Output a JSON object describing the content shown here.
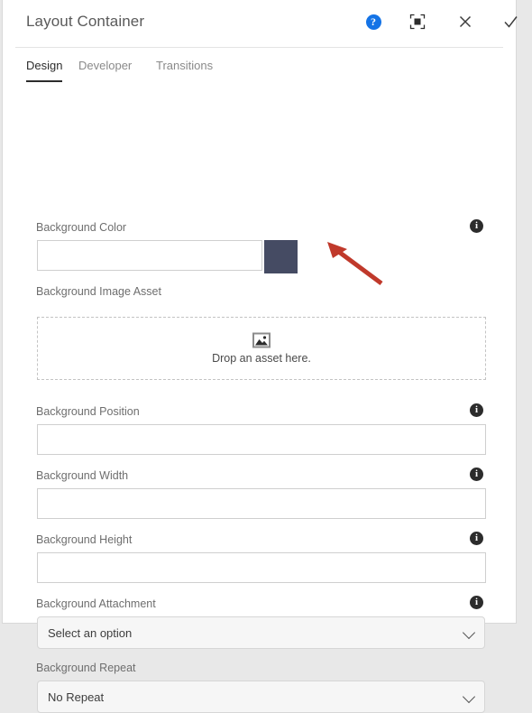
{
  "header": {
    "title": "Layout Container",
    "actions": [
      {
        "name": "help-button",
        "icon": "help-circle-icon",
        "glyph": "?"
      },
      {
        "name": "expand-button",
        "icon": "fullscreen-icon"
      },
      {
        "name": "close-button",
        "icon": "close-icon"
      },
      {
        "name": "confirm-button",
        "icon": "check-icon"
      }
    ]
  },
  "tabs": [
    {
      "label": "Design",
      "active": true
    },
    {
      "label": "Developer",
      "active": false
    },
    {
      "label": "Transitions",
      "active": false
    }
  ],
  "form": {
    "background_color": {
      "label": "Background Color",
      "value": "",
      "swatch_color": "#454B63",
      "info": "i"
    },
    "background_image_asset": {
      "label": "Background Image Asset",
      "dropzone_text": "Drop an asset here.",
      "dropzone_icon": "image-placeholder-icon"
    },
    "background_position": {
      "label": "Background Position",
      "value": "",
      "info": "i"
    },
    "background_width": {
      "label": "Background Width",
      "value": "",
      "info": "i"
    },
    "background_height": {
      "label": "Background Height",
      "value": "",
      "info": "i"
    },
    "background_attachment": {
      "label": "Background Attachment",
      "value": "Select an option",
      "info": "i"
    },
    "background_repeat": {
      "label": "Background Repeat",
      "value": "No Repeat"
    }
  },
  "annotation": {
    "arrow_color": "#C0392B",
    "points_at": "background-image-dropzone"
  }
}
